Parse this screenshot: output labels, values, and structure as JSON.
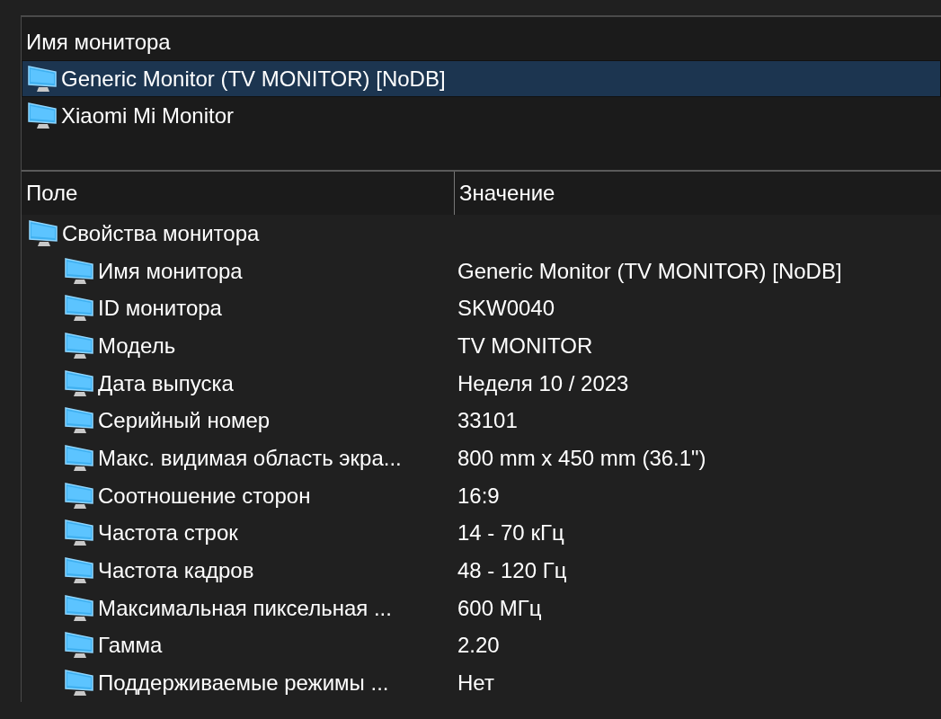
{
  "monitor_list": {
    "column": "Имя монитора",
    "items": [
      {
        "name": "Generic Monitor (TV MONITOR) [NoDB]",
        "selected": true
      },
      {
        "name": "Xiaomi Mi Monitor",
        "selected": false
      }
    ]
  },
  "properties": {
    "columns": [
      "Поле",
      "Значение"
    ],
    "tree": [
      {
        "field": "Свойства монитора",
        "children": [
          {
            "field": "Имя монитора",
            "value": "Generic Monitor (TV MONITOR) [NoDB]"
          },
          {
            "field": "ID монитора",
            "value": "SKW0040"
          },
          {
            "field": "Модель",
            "value": "TV MONITOR"
          },
          {
            "field": "Дата выпуска",
            "value": "Неделя 10 / 2023"
          },
          {
            "field": "Серийный номер",
            "value": "33101"
          },
          {
            "field": "Макс. видимая область экра...",
            "value": "800 mm x 450 mm (36.1\")"
          },
          {
            "field": "Соотношение сторон",
            "value": "16:9"
          },
          {
            "field": "Частота строк",
            "value": "14 - 70 кГц"
          },
          {
            "field": "Частота кадров",
            "value": "48 - 120 Гц"
          },
          {
            "field": "Максимальная пиксельная ...",
            "value": "600 МГц"
          },
          {
            "field": "Гамма",
            "value": "2.20"
          },
          {
            "field": "Поддерживаемые режимы ...",
            "value": "Нет"
          }
        ]
      }
    ]
  }
}
